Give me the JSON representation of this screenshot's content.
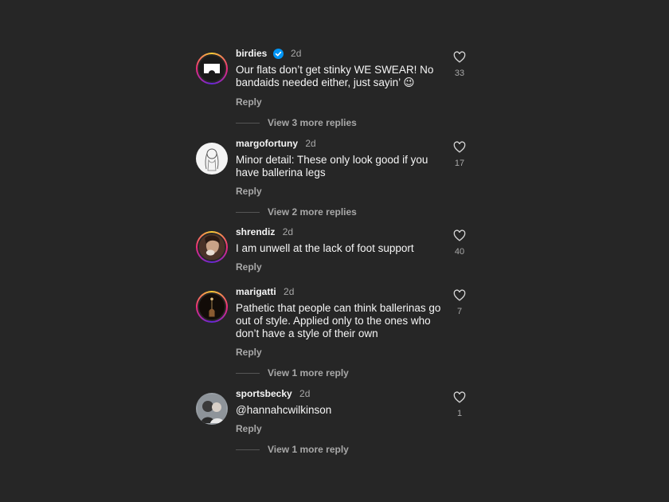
{
  "comments": [
    {
      "username": "birdies",
      "verified": true,
      "time": "2d",
      "text": "Our flats don’t get stinky WE SWEAR! No bandaids needed either, just sayin’ 😉",
      "likes": "33",
      "reply_label": "Reply",
      "view_more": "View 3 more replies"
    },
    {
      "username": "margofortuny",
      "time": "2d",
      "text": "Minor detail: These only look good if you have ballerina legs",
      "likes": "17",
      "reply_label": "Reply",
      "view_more": "View 2 more replies"
    },
    {
      "username": "shrendiz",
      "time": "2d",
      "text": "I am unwell at the lack of foot support",
      "likes": "40",
      "reply_label": "Reply"
    },
    {
      "username": "marigatti",
      "time": "2d",
      "text": "Pathetic that people can think ballerinas go out of style. Applied only to the ones who don’t have a style of their own",
      "likes": "7",
      "reply_label": "Reply",
      "view_more": "View 1 more reply"
    },
    {
      "username": "sportsbecky",
      "time": "2d",
      "text": "@hannahcwilkinson",
      "likes": "1",
      "reply_label": "Reply",
      "view_more": "View 1 more reply"
    }
  ],
  "colors": {
    "background": "#262626",
    "verified": "#0095f6",
    "muted_text": "#a8a8a8"
  },
  "icons": [
    "verified-badge-icon",
    "heart-icon"
  ]
}
